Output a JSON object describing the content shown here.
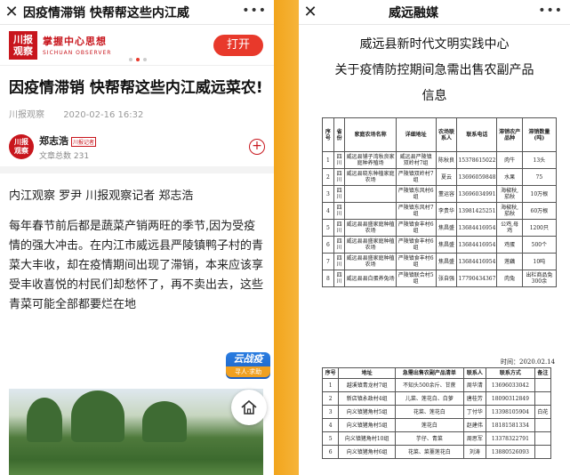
{
  "left": {
    "topbar_title": "因疫情滞销 快帮帮这些内江威",
    "banner": {
      "logo_line1": "川报",
      "logo_line2": "观察",
      "slogan": "掌握中心思想",
      "sub": "SICHUAN OBSERVER",
      "open_label": "打开"
    },
    "article_title": "因疫情滞销 快帮帮这些内江威远菜农!",
    "source": "川报观察",
    "datetime": "2020-02-16 16:32",
    "author": {
      "avatar_l1": "川报",
      "avatar_l2": "观察",
      "name": "郑志浩",
      "badge": "川报记者",
      "count": "文章总数 231"
    },
    "byline": "内江观察 罗尹 川报观察记者 郑志浩",
    "paragraph": "每年春节前后都是蔬菜产销两旺的季节,因为受疫情的强大冲击。在内江市威远县严陵镇鸭子村的青菜大丰收，却在疫情期间出现了滞销，本来应该享受丰收喜悦的村民们却愁怀了，再不卖出去，这些青菜可能全部都要烂在地",
    "cloud_badge_main": "云战疫",
    "cloud_badge_sub": "寻人·求助"
  },
  "right": {
    "topbar_title": "威远融媒",
    "doc_title_lines": [
      "威远县新时代文明实践中心",
      "关于疫情防控期间急需出售农副产品",
      "信息"
    ],
    "watermark": "",
    "table1": {
      "headers": [
        "序号",
        "省份",
        "家庭农场名称",
        "详细地址",
        "农场联系人",
        "联系电话",
        "滞销农产品种",
        "滞销数量(吨)"
      ],
      "rows": [
        [
          "1",
          "四川",
          "威远县铺子湾秋良家庭种养殖场",
          "威远县严陵镇双岭村7组",
          "陈秋良",
          "15378615022",
          "肉牛",
          "13头"
        ],
        [
          "2",
          "四川",
          "威远县晓东种植家庭农场",
          "严陵镇双岭村7组",
          "夏云",
          "13696059848",
          "水果",
          "75"
        ],
        [
          "3",
          "四川",
          "",
          "严陵镇东风村6组",
          "董运容",
          "13696034991",
          "海椒秋,茄秋",
          "10万根"
        ],
        [
          "4",
          "四川",
          "",
          "严陵镇东风村7组",
          "李贵华",
          "13981425251",
          "海椒秋,茄秋",
          "60万根"
        ],
        [
          "5",
          "四川",
          "威远县县盛家庭种植农场",
          "严陵镇食丰村6组",
          "焦昌盛",
          "13684416954",
          "公鸡,母鸡",
          "1200只"
        ],
        [
          "6",
          "四川",
          "威远县县盛家庭种植农场",
          "严陵镇食丰村6组",
          "焦昌盛",
          "13684416954",
          "鸡蛋",
          "500个"
        ],
        [
          "7",
          "四川",
          "威远县县盛家庭种植农场",
          "严陵镇食丰村6组",
          "焦昌盛",
          "13684416954",
          "莲藕",
          "10吨"
        ],
        [
          "8",
          "四川",
          "威远县县白蛋养兔场",
          "严陵镇联合村5组",
          "张自强",
          "17790434367",
          "肉兔",
          "出栏商品兔300余"
        ]
      ]
    },
    "date": "时间：2020.02.14",
    "table2": {
      "headers": [
        "序号",
        "地址",
        "急需出售农副产品清单",
        "联系人",
        "联系方式",
        "备注"
      ],
      "rows": [
        [
          "1",
          "越溪镇青龙村7组",
          "不知头500余斤、甘蔗",
          "周华清",
          "13696033042",
          ""
        ],
        [
          "2",
          "新店镇永政村4组",
          "儿菜、莲花白、白萝",
          "唐桂芳",
          "18090312849",
          ""
        ],
        [
          "3",
          "向义镇猪角村5组",
          "花菜、莲花白",
          "丁付华",
          "13398105904",
          "白花"
        ],
        [
          "4",
          "向义镇猪角村5组",
          "莲花白",
          "赵建伟",
          "18181581334",
          ""
        ],
        [
          "5",
          "向义镇猪角村10组",
          "芋仔、青菜",
          "周思军",
          "13378322791",
          ""
        ],
        [
          "6",
          "向义镇猪角村6组",
          "花菜、菜薹莲花白",
          "刘涛",
          "13880526093",
          ""
        ]
      ]
    }
  }
}
